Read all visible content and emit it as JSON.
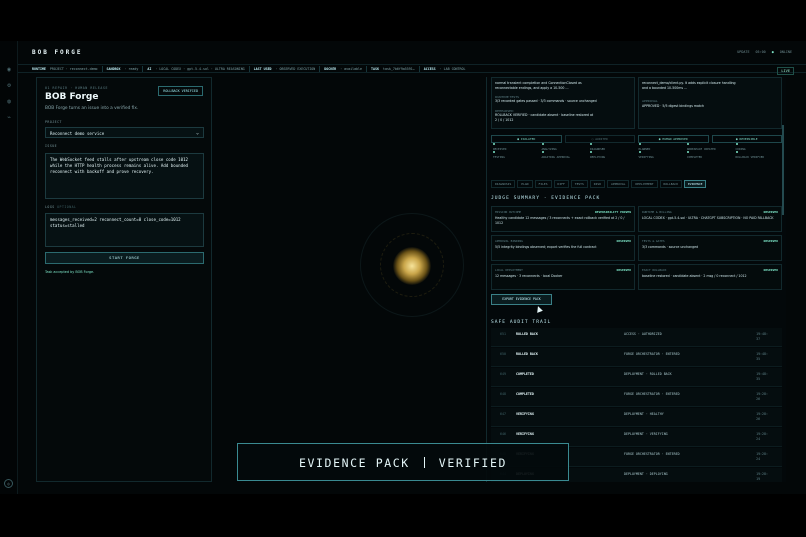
{
  "header": {
    "brand": "BOB FORGE",
    "right_items": [
      "UPDATE",
      "05:00",
      "ONLINE"
    ]
  },
  "statusbar": [
    {
      "k": "RUNTIME",
      "v": "PROJECT · reconnect-demo"
    },
    {
      "k": "SANDBOX",
      "v": "· ready"
    },
    {
      "k": "AI",
      "v": "· LOCAL CODEX · gpt-5.4-sol · ULTRA REASONING"
    },
    {
      "k": "LAST USED",
      "v": "· OBSERVED EXECUTION"
    },
    {
      "k": "DOCKER",
      "v": "· available"
    },
    {
      "k": "TASK",
      "v": "task_7b6f9a5591…"
    },
    {
      "k": "ACCESS",
      "v": "· LAB CONTROL"
    }
  ],
  "live_label": "LIVE",
  "left": {
    "eyebrow": "01 REPAIR · HUMAN RELEASE",
    "title": "BOB Forge",
    "subtitle": "BOB Forge turns an issue into a verified fix.",
    "badge": "ROLLBACK VERIFIED",
    "project_label": "PROJECT",
    "project_value": "Reconnect demo service",
    "issue_label": "ISSUE",
    "issue_text": "The WebSocket feed stalls after upstream close code 1012 while the HTTP health process remains alive. Add bounded reconnect with backoff and prove recovery.",
    "logs_label": "LOGS",
    "logs_opt": "OPTIONAL",
    "logs_text": "messages_received=2 reconnect_count=0 close_code=1012 status=stalled",
    "start_button": "START FORGE",
    "accepted": "Task accepted by BOB Forge."
  },
  "right": {
    "top_cards": [
      {
        "lines": [
          "normal transient completion and ConnectionClosed as",
          "reconnectable endings, and apply a 10-500 …",
          "",
          "RUNTIME TESTS",
          "3/3 recorded gates passed · 3/3 commands · source unchanged",
          "",
          "REHEARSED",
          "ROLLBACK VERIFIED · candidate absent · baseline restored at",
          "2 / 0 / 1012"
        ]
      },
      {
        "lines": [
          "reconnect_demo/client.py. It adds explicit closure handling",
          "and a bounded 10-500ms …",
          "",
          "",
          "APPROVAL",
          "APPROVED · 5/5 digest bindings match"
        ]
      }
    ],
    "chips": [
      {
        "label": "● ISOLATED",
        "dim": false
      },
      {
        "label": "○ AUDITED",
        "dim": true
      },
      {
        "label": "● HUMAN APPROVED",
        "dim": false
      },
      {
        "label": "● REVERSIBLE",
        "dim": false
      }
    ],
    "steps": [
      "RECEIVED",
      "ANALYZING",
      "DIAGNOSED",
      "PLANNED",
      "WORKSPACE CREATED",
      "CODING",
      "TESTING",
      "AWAITING APPROVAL",
      "DEPLOYING",
      "VERIFYING",
      "COMPLETED",
      "ROLLBACK VERIFIED"
    ],
    "tabs": [
      {
        "label": "DIAGNOSIS",
        "active": false
      },
      {
        "label": "PLAN",
        "active": false
      },
      {
        "label": "FILES",
        "active": false
      },
      {
        "label": "DIFF",
        "active": false
      },
      {
        "label": "TESTS",
        "active": false
      },
      {
        "label": "RISK",
        "active": false
      },
      {
        "label": "APPROVAL",
        "active": false
      },
      {
        "label": "DEPLOYMENT",
        "active": false
      },
      {
        "label": "ROLLBACK",
        "active": false
      },
      {
        "label": "EVIDENCE",
        "active": true
      }
    ],
    "judge_title": "JUDGE SUMMARY · EVIDENCE PACK",
    "cells": [
      {
        "h": "MISSION OUTCOME",
        "s": "REVERSIBILITY PROVEN",
        "b": "Healthy candidate 12 messages / 3 reconnects + exact rollback verified at 2 / 0 / 1012"
      },
      {
        "h": "RUNTIME & BILLING",
        "s": "OBSERVED",
        "b": "LOCAL CODEX · gpt-5.4-sol · ULTRA · CHATGPT SUBSCRIPTION · NO PAID FALLBACK"
      },
      {
        "h": "APPROVAL BINDING",
        "s": "OBSERVED",
        "b": "5/5 integrity bindings observed; export verifies the full contract"
      },
      {
        "h": "TESTS & GATES",
        "s": "OBSERVED",
        "b": "3/3 commands · source unchanged"
      },
      {
        "h": "LOCAL DEPLOYMENT",
        "s": "OBSERVED",
        "b": "12 messages · 3 reconnects · local Docker"
      },
      {
        "h": "EXACT ROLLBACK",
        "s": "OBSERVED",
        "b": "baseline restored · candidate absent · 2 msg / 0 reconnect / 1012"
      }
    ],
    "export_button": "EXPORT EVIDENCE PACK",
    "audit_title": "SAFE AUDIT TRAIL",
    "audit_rows": [
      {
        "n": "651",
        "st": "ROLLED BACK",
        "ev": "ACCESS · AUTHORIZED",
        "t1": "19:48:",
        "t2": "37"
      },
      {
        "n": "650",
        "st": "ROLLED BACK",
        "ev": "FORGE ORCHESTRATOR · ENTERED",
        "t1": "19:48:",
        "t2": "35"
      },
      {
        "n": "649",
        "st": "COMPLETED",
        "ev": "DEPLOYMENT · ROLLED BACK",
        "t1": "19:48:",
        "t2": "35"
      },
      {
        "n": "648",
        "st": "COMPLETED",
        "ev": "FORGE ORCHESTRATOR · ENTERED",
        "t1": "19:28:",
        "t2": "26"
      },
      {
        "n": "647",
        "st": "VERIFYING",
        "ev": "DEPLOYMENT · HEALTHY",
        "t1": "19:28:",
        "t2": "26"
      },
      {
        "n": "646",
        "st": "VERIFYING",
        "ev": "DEPLOYMENT · VERIFYING",
        "t1": "19:28:",
        "t2": "24"
      },
      {
        "n": "645",
        "st": "VERIFYING",
        "ev": "FORGE ORCHESTRATOR · ENTERED",
        "t1": "19:28:",
        "t2": "24"
      },
      {
        "n": "644",
        "st": "DEPLOYING",
        "ev": "DEPLOYMENT · DEPLOYING",
        "t1": "19:28:",
        "t2": "19"
      }
    ]
  },
  "overlay": {
    "left": "EVIDENCE PACK",
    "right": "VERIFIED"
  }
}
